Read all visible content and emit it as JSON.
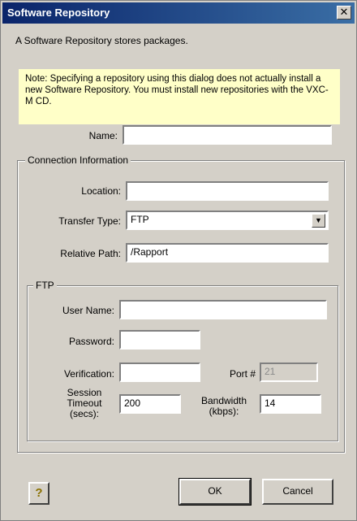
{
  "window": {
    "title": "Software Repository",
    "close_label": "✕"
  },
  "description": "A Software Repository stores packages.",
  "note": "Note: Specifying a repository using this dialog does not actually install a new Software Repository.  You must install new repositories with the VXC-M CD.",
  "name": {
    "label": "Name:",
    "value": ""
  },
  "connection": {
    "group_title": "Connection Information",
    "location": {
      "label": "Location:",
      "value": ""
    },
    "transfer_type": {
      "label": "Transfer Type:",
      "value": "FTP"
    },
    "relative_path": {
      "label": "Relative Path:",
      "value": "/Rapport"
    }
  },
  "ftp": {
    "group_title": "FTP",
    "user_name": {
      "label": "User Name:",
      "value": ""
    },
    "password": {
      "label": "Password:",
      "value": ""
    },
    "verification": {
      "label": "Verification:",
      "value": ""
    },
    "port": {
      "label": "Port #",
      "value": "21"
    },
    "session_timeout": {
      "label_line1": "Session",
      "label_line2": "Timeout",
      "label_line3": "(secs):",
      "value": "200"
    },
    "bandwidth": {
      "label_line1": "Bandwidth",
      "label_line2": "(kbps):",
      "value": "14"
    }
  },
  "buttons": {
    "help_label": "?",
    "ok_label": "OK",
    "cancel_label": "Cancel"
  }
}
